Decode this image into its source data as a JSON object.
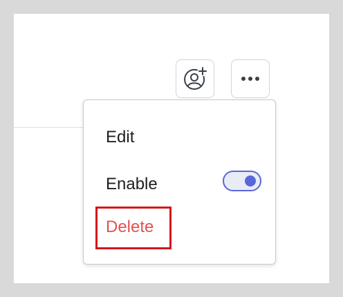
{
  "toolbar": {
    "add_user_icon": "user-circle-plus-icon",
    "more_icon": "more-horizontal-icon"
  },
  "menu": {
    "items": [
      {
        "label": "Edit"
      },
      {
        "label": "Enable",
        "toggle": {
          "on": true
        }
      },
      {
        "label": "Delete",
        "color": "#e4504f"
      }
    ],
    "highlight_color": "#d4141c"
  },
  "colors": {
    "accent": "#5867d9",
    "background": "#d9d9d9",
    "panel": "#ffffff"
  }
}
